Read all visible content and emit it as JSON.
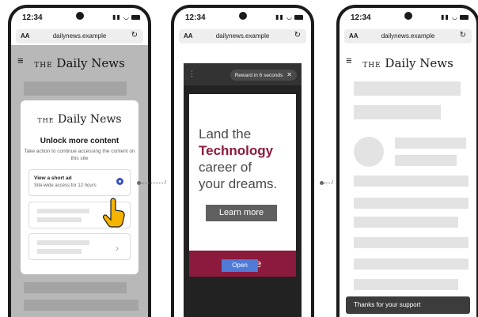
{
  "status_bar": {
    "time": "12:34",
    "signal": "📶",
    "wifi": "◠"
  },
  "browser": {
    "text_size_label": "AA",
    "domain": "dailynews.example",
    "reload_icon": "reload-icon"
  },
  "site": {
    "title_prefix": "THE",
    "title_name": "Daily News"
  },
  "paywall": {
    "heading": "Unlock more content",
    "description": "Take action to continue accessing the content on this site",
    "options": [
      {
        "title": "View a short ad",
        "subtitle": "Site-wide access for 12 hours",
        "selected": true
      }
    ]
  },
  "ad": {
    "reward_text": "Reward in 6 seconds",
    "close_glyph": "✕",
    "menu_glyph": "⋮",
    "headline_1": "Land the",
    "headline_accent": "Technology",
    "headline_2": "career of",
    "headline_3": "your dreams.",
    "cta": "Learn more",
    "brand": "College",
    "open_label": "Open",
    "colors": {
      "accent": "#8b1a3c",
      "open_button": "#4f7ad6"
    }
  },
  "confirmation": {
    "toast": "Thanks for your support"
  }
}
